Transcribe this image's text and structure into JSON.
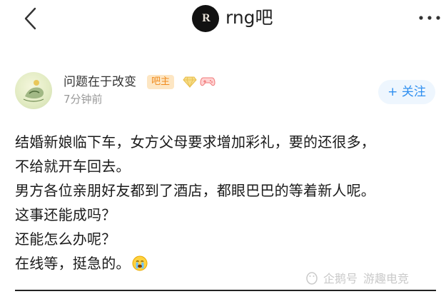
{
  "header": {
    "back_icon": "chevron-left-icon",
    "forum_name": "rng吧",
    "more_icon": "more-dots-icon"
  },
  "post": {
    "author": "问题在于改变",
    "role_badge": "吧主",
    "time": "7分钟前",
    "follow_label": "+ 关注",
    "lines": [
      "结婚新娘临下车，女方父母要求增加彩礼，要的还很多，",
      "不给就开车回去。",
      "男方各位亲朋好友都到了酒店，都眼巴巴的等着新人呢。",
      "这事还能成吗？",
      "还能怎么办呢？",
      "在线等，挺急的。"
    ],
    "trailing_emoji": "crying-emoji-icon"
  },
  "watermark": {
    "source": "企鹅号",
    "author": "游趣电竞"
  },
  "colors": {
    "badge_bg": "#fde6c3",
    "badge_text": "#f08a1c",
    "follow_bg": "#eef6fe",
    "follow_text": "#2f8ff0"
  }
}
